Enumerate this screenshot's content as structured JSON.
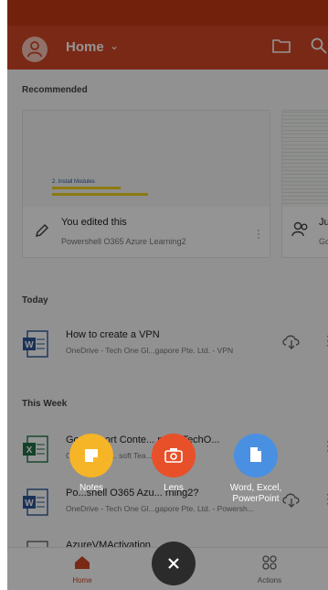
{
  "header": {
    "title": "Home"
  },
  "recommended": {
    "section_title": "Recommended",
    "cards": [
      {
        "title": "You edited this",
        "subtitle": "Powershell O365 Azure Learning2",
        "preview_heading": "2. Install Modules"
      },
      {
        "title": "Ju",
        "subtitle": "Go"
      }
    ]
  },
  "today": {
    "section_title": "Today",
    "files": [
      {
        "name": "How to create a VPN",
        "location": "OneDrive - Tech One Gl...gapore Pte. Ltd. - VPN"
      }
    ]
  },
  "this_week": {
    "section_title": "This Week",
    "files": [
      {
        "name": "Go...Export Conte... mary TechO...",
        "location": "On... lobal Si... soft Tea... es"
      },
      {
        "name": "Po...shell O365 Azu... rning2?",
        "location": "OneDrive - Tech One Gl...gapore Pte. Ltd. - Powersh..."
      },
      {
        "name": "AzureVMActivation",
        "location": ""
      }
    ]
  },
  "actions": {
    "notes": "Notes",
    "lens": "Lens",
    "office_line1": "Word, Excel,",
    "office_line2": "PowerPoint"
  },
  "bottom_nav": {
    "home": "Home",
    "actions": "Actions"
  },
  "colors": {
    "brand": "#d24726",
    "word": "#2b579a",
    "excel": "#217346",
    "notes": "#f6b427",
    "lens": "#e8502a",
    "office": "#4a90e2"
  }
}
